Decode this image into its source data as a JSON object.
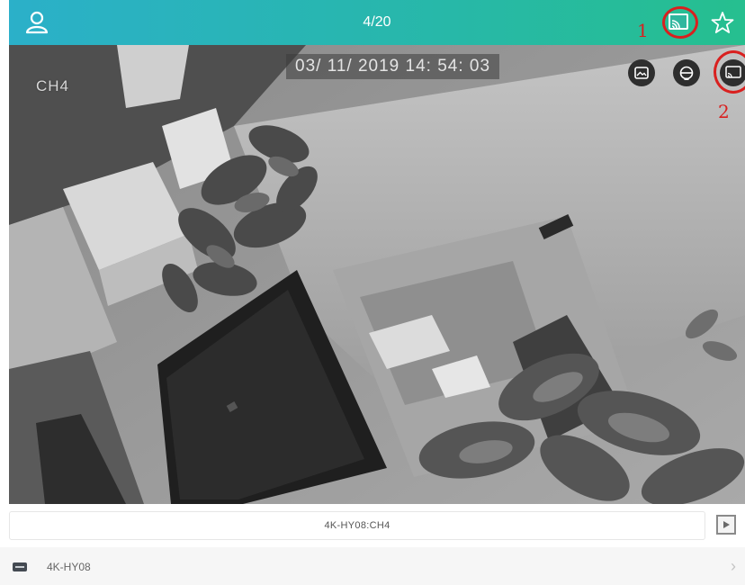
{
  "header": {
    "counter": "4/20",
    "user_icon": "user-icon",
    "cast_icon": "cast-icon",
    "favorite_icon": "star-icon",
    "bar_colors": [
      "#2bb0c9",
      "#26bf8f"
    ]
  },
  "annotations": {
    "marker1": "1",
    "marker2": "2",
    "marker_color": "#d9201f"
  },
  "video": {
    "channel_label": "CH4",
    "timestamp": "03/ 11/ 2019  14: 54: 03",
    "controls": [
      "snapshot-icon",
      "ptz-icon",
      "cast-icon"
    ]
  },
  "channel_bar": {
    "label": "4K-HY08:CH4",
    "play_icon": "play-icon"
  },
  "device_list": {
    "items": [
      {
        "name": "4K-HY08",
        "icon": "dvr-device-icon",
        "chevron": "›"
      }
    ]
  }
}
